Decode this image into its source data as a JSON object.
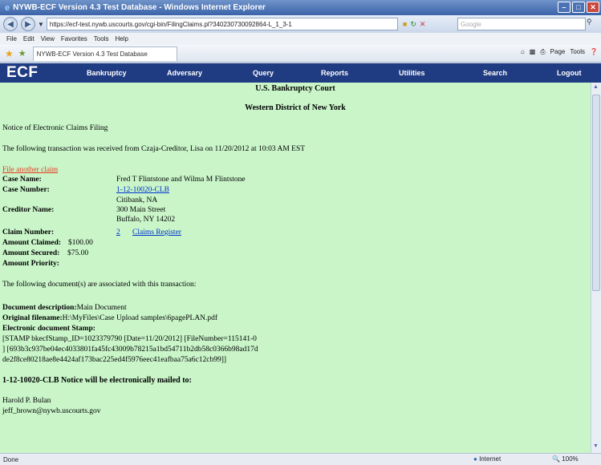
{
  "window": {
    "title": "NYWB-ECF Version 4.3 Test Database - Windows Internet Explorer"
  },
  "address_bar": {
    "url": "https://ecf-test.nywb.uscourts.gov/cgi-bin/FilingClaims.pl?340230730092864-L_1_3-1",
    "search_placeholder": "Google"
  },
  "menu": [
    "File",
    "Edit",
    "View",
    "Favorites",
    "Tools",
    "Help"
  ],
  "tab": {
    "label": "NYWB-ECF Version 4.3 Test Database"
  },
  "command_bar": {
    "page_label": "Page",
    "tools_label": "Tools"
  },
  "ecf_nav": {
    "logo": "ECF",
    "items": [
      "Bankruptcy",
      "Adversary",
      "Query",
      "Reports",
      "Utilities",
      "Search",
      "Logout"
    ]
  },
  "page": {
    "court_name": "U.S. Bankruptcy Court",
    "district": "Western District of New York",
    "heading": "Notice of Electronic Claims Filing",
    "transaction_text": "The following transaction was received from Czaja-Creditor, Lisa on 11/20/2012 at 10:03 AM EST",
    "file_another_claim": "File another claim",
    "case_name_label": "Case Name:",
    "case_name": "Fred T Flintstone and Wilma M Flintstone",
    "case_number_label": "Case Number:",
    "case_number": "1-12-10020-CLB",
    "creditor_label": "Creditor Name:",
    "creditor_lines": [
      "Citibank, NA",
      "300 Main Street",
      "Buffalo, NY 14202"
    ],
    "claim_number_label": "Claim Number:",
    "claim_number": "2",
    "claims_register": "Claims Register",
    "amount_claimed_label": "Amount Claimed:",
    "amount_claimed": "$100.00",
    "amount_secured_label": "Amount Secured:",
    "amount_secured": "$75.00",
    "amount_priority_label": "Amount Priority:",
    "documents_text": "The following document(s) are associated with this transaction:",
    "doc_description_label": "Document description:",
    "doc_description": "Main Document",
    "original_filename_label": "Original filename:",
    "original_filename": "H:\\MyFiles\\Case Upload samples\\6pagePLAN.pdf",
    "stamp_label": "Electronic document Stamp:",
    "stamp_lines": [
      "[STAMP bkecfStamp_ID=1023379790 [Date=11/20/2012] [FileNumber=115141-0",
      "] [693b3c937be04ec4033801fa45fc43009b78215a1bd54711b2db58c0366b98ad17d",
      "de2f8ce80218ae8e4424af173bac225ed4f5976eec41eafbaa75a6c12cb99]]"
    ],
    "mailed_heading": "1-12-10020-CLB Notice will be electronically mailed to:",
    "recipient_name": "Harold P. Bulan",
    "recipient_email": "jeff_brown@nywb.uscourts.gov"
  },
  "status_bar": {
    "status": "Done",
    "zone": "Internet",
    "zoom": "100%"
  }
}
